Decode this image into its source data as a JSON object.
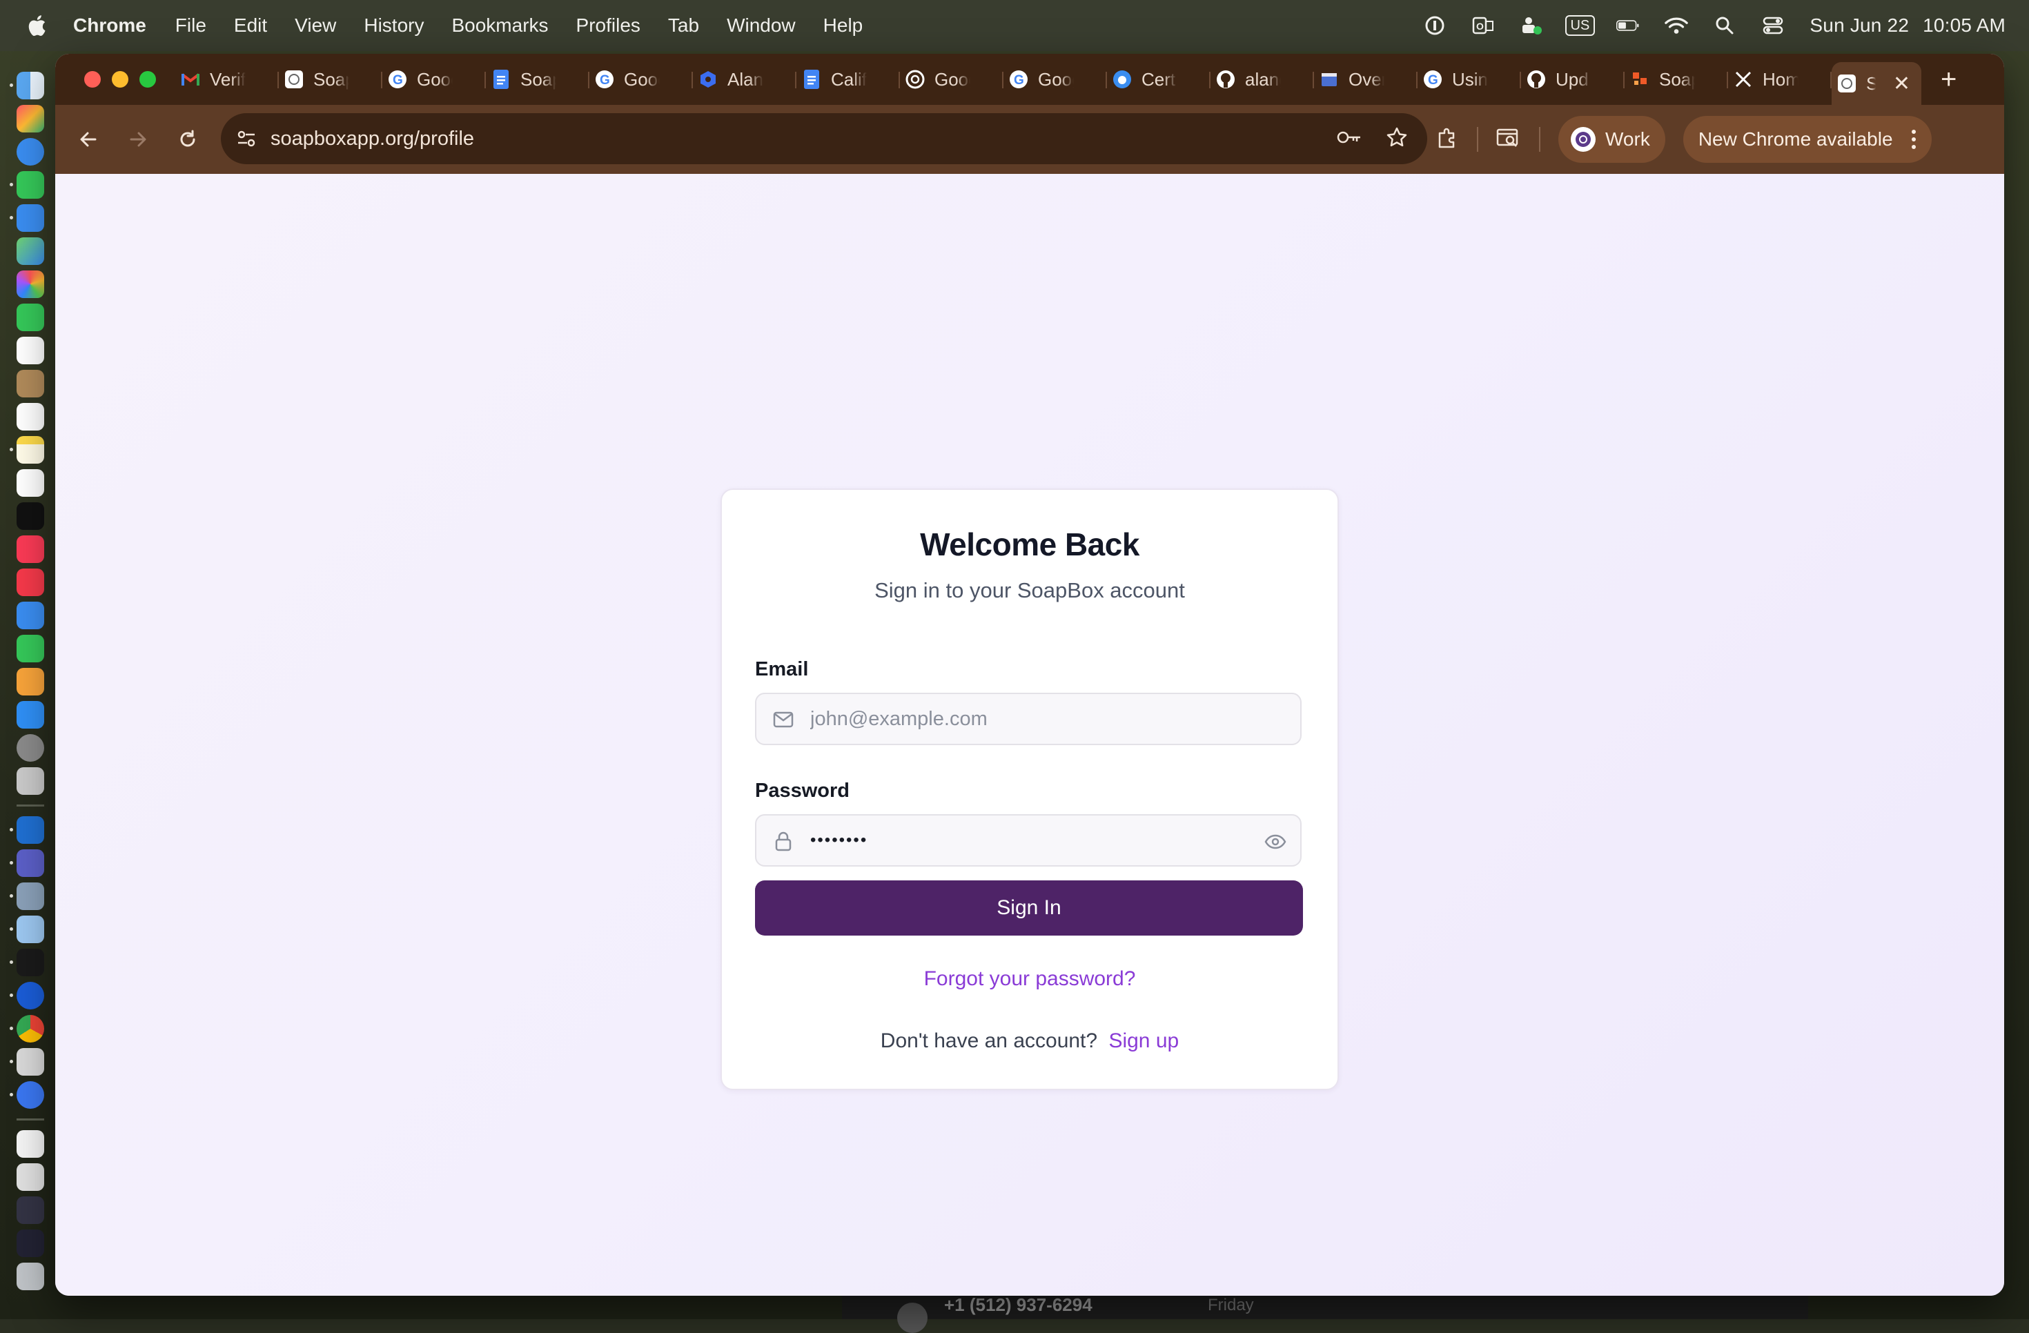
{
  "menubar": {
    "app_name": "Chrome",
    "items": [
      "File",
      "Edit",
      "View",
      "History",
      "Bookmarks",
      "Profiles",
      "Tab",
      "Window",
      "Help"
    ],
    "input_source": "US",
    "date": "Sun Jun 22",
    "time": "10:05 AM"
  },
  "browser": {
    "tabs": [
      {
        "label": "Verif",
        "icon": "gmail-icon"
      },
      {
        "label": "Soap",
        "icon": "soapbox-icon"
      },
      {
        "label": "Goog",
        "icon": "google-icon"
      },
      {
        "label": "Soap",
        "icon": "docs-icon"
      },
      {
        "label": "Goog",
        "icon": "google-icon"
      },
      {
        "label": "Alan",
        "icon": "blue-hex-icon"
      },
      {
        "label": "Calif",
        "icon": "docs-icon"
      },
      {
        "label": "Goog",
        "icon": "openai-icon"
      },
      {
        "label": "Goog",
        "icon": "google-icon"
      },
      {
        "label": "Cert",
        "icon": "apple-dev-icon"
      },
      {
        "label": "alang",
        "icon": "github-icon"
      },
      {
        "label": "Over",
        "icon": "store-icon"
      },
      {
        "label": "Usin",
        "icon": "google-icon"
      },
      {
        "label": "Upd",
        "icon": "github-icon"
      },
      {
        "label": "Soap",
        "icon": "orange-logo-icon"
      },
      {
        "label": "Hom",
        "icon": "x-icon"
      },
      {
        "label": "S",
        "icon": "soapbox-icon",
        "active": true
      }
    ],
    "url": "soapboxapp.org/profile",
    "profile_label": "Work",
    "update_label": "New Chrome available"
  },
  "login": {
    "title": "Welcome Back",
    "subtitle": "Sign in to your SoapBox account",
    "email_label": "Email",
    "email_placeholder": "john@example.com",
    "password_label": "Password",
    "password_value": "••••••••",
    "submit_label": "Sign In",
    "forgot_label": "Forgot your password?",
    "signup_prompt": "Don't have an account?",
    "signup_link": "Sign up"
  },
  "background_window": {
    "phone": "+1 (512) 937-6294",
    "day": "Friday"
  },
  "colors": {
    "accent_primary": "#4e2367",
    "link": "#8a3bd6",
    "chrome_frame": "#5e3c26",
    "page_bg": "#f3effd"
  }
}
